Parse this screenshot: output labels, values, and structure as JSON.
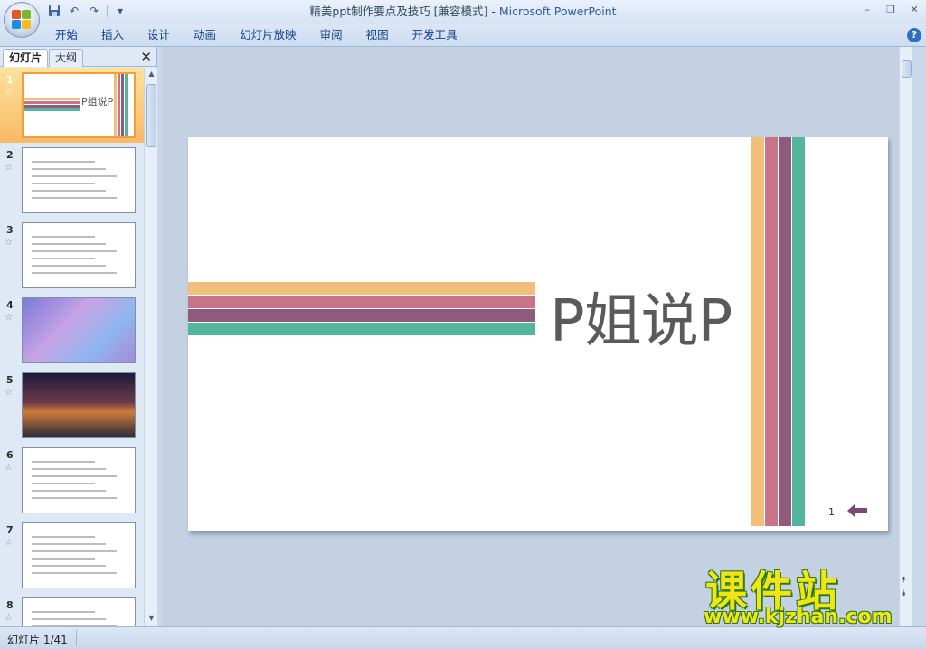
{
  "window": {
    "title_doc": "精美ppt制作要点及技巧 [兼容模式]",
    "title_sep": " - ",
    "title_app": "Microsoft PowerPoint",
    "minimize_glyph": "–",
    "restore_glyph": "❐",
    "close_glyph": "✕"
  },
  "quick_access": {
    "save_icon": "floppy-disk-icon",
    "undo_glyph": "↶",
    "redo_glyph": "↷",
    "more_glyph": "▾"
  },
  "ribbon": {
    "tabs": [
      "开始",
      "插入",
      "设计",
      "动画",
      "幻灯片放映",
      "审阅",
      "视图",
      "开发工具"
    ],
    "help_glyph": "?"
  },
  "left_panel": {
    "tab_slides": "幻灯片",
    "tab_outline": "大纲",
    "close_glyph": "✕",
    "selected_index": 0,
    "thumbnails": [
      {
        "number": "1",
        "title": "P姐说P"
      },
      {
        "number": "2",
        "title": ""
      },
      {
        "number": "3",
        "title": ""
      },
      {
        "number": "4",
        "title": ""
      },
      {
        "number": "5",
        "title": ""
      },
      {
        "number": "6",
        "title": ""
      },
      {
        "number": "7",
        "title": ""
      },
      {
        "number": "8",
        "title": ""
      }
    ],
    "star_glyph": "☆"
  },
  "slide": {
    "title": "P姐说P",
    "page_number": "1",
    "colors": {
      "orange": "#f2bf7a",
      "pink": "#c87488",
      "purple": "#8f5a7c",
      "teal": "#52b59c"
    }
  },
  "status": {
    "slide_info": "幻灯片 1/41"
  },
  "watermark": {
    "logo": "课件站",
    "url": "www.kjzhan.com"
  }
}
